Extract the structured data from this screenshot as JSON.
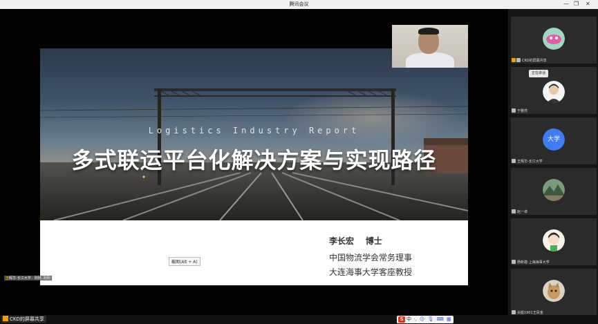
{
  "window": {
    "title": "腾讯会议",
    "minimize": "—",
    "restore": "❐",
    "close": "✕"
  },
  "slide": {
    "subtitle": "Logistics  Industry  Report",
    "headline": "多式联运平台化解决方案与实现路径",
    "author": "李长宏    博士",
    "affiliation_1": "中国物流学会常务理事",
    "affiliation_2": "大连海事大学客座教授",
    "shortcut_tip": "截图(Alt + A)"
  },
  "presenter": {
    "name_tag_prefix": "王",
    "name_tag": "辉华-长江大学 · 刚刚, 刚刚"
  },
  "bottom": {
    "share_label": "CKD的屏幕共享",
    "ime": {
      "logo": "S",
      "lang": "中",
      "tools": [
        "·,",
        "☺",
        "🎙",
        "⌨",
        "▦"
      ]
    }
  },
  "participants": [
    {
      "label": "CKD的屏幕共享",
      "avatar": "blob-icon",
      "screen_share": true
    },
    {
      "label": "于雅然",
      "avatar": "person-icon",
      "speaking_tip": "正在讲话"
    },
    {
      "label": "王辉华-长江大学",
      "avatar_text": "大学"
    },
    {
      "label": "赵一卓",
      "avatar": "landscape-icon"
    },
    {
      "label": "杨新建-上海海事大学",
      "avatar": "cartoon-icon"
    },
    {
      "label": "尖庭1901王凤金",
      "avatar": "cat-icon"
    }
  ],
  "colors": {
    "accent_orange": "#f0a000",
    "avatar_blue": "#3d7cf2",
    "ime_red": "#e2301e"
  }
}
